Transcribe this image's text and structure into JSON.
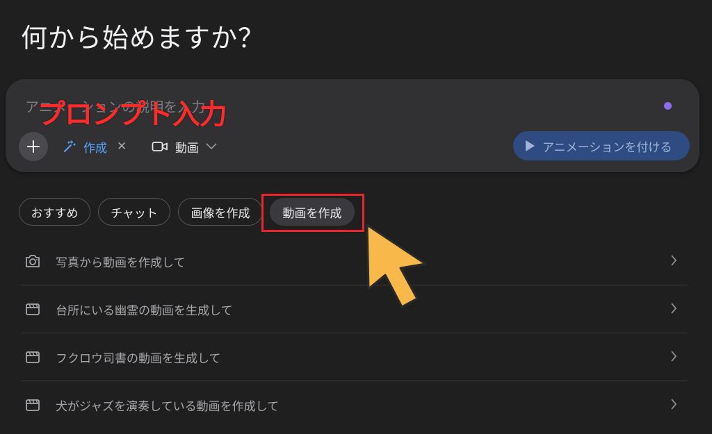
{
  "page": {
    "title": "何から始めますか？"
  },
  "prompt": {
    "placeholder": "アニメーションの説明を入力",
    "overlay_label": "プロンプト入力",
    "create_chip_label": "作成",
    "create_chip_close": "✕",
    "media_chip_label": "動画",
    "animate_button_label": "アニメーションを付ける",
    "accent_color": "#5aa5ff",
    "dot_color": "#8b6cf0"
  },
  "filters": [
    {
      "label": "おすすめ",
      "active": false
    },
    {
      "label": "チャット",
      "active": false
    },
    {
      "label": "画像を作成",
      "active": false
    },
    {
      "label": "動画を作成",
      "active": true
    }
  ],
  "suggestions": [
    {
      "icon": "camera-icon",
      "text": "写真から動画を作成して"
    },
    {
      "icon": "clapperboard-icon",
      "text": "台所にいる幽霊の動画を生成して"
    },
    {
      "icon": "clapperboard-icon",
      "text": "フクロウ司書の動画を生成して"
    },
    {
      "icon": "clapperboard-icon",
      "text": "犬がジャズを演奏している動画を作成して"
    }
  ],
  "annotation": {
    "highlight_color": "#e8262d",
    "arrow_color": "#f9b84a"
  }
}
